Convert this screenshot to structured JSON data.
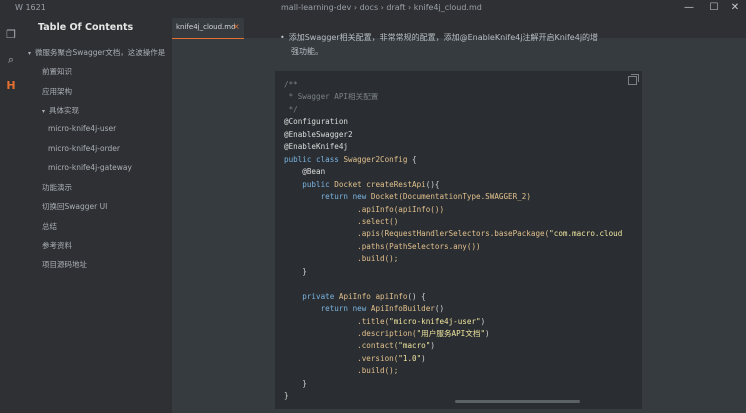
{
  "window": {
    "word_count": "W 1621",
    "path": "mall-learning-dev › docs › draft › knife4j_cloud.md",
    "controls": {
      "minimize": "—",
      "maximize": "☐",
      "close": "✕"
    }
  },
  "colors": {
    "accent": "#e57030",
    "comment": "#7a8187",
    "keyword": "#7ab3e0",
    "type": "#e2c08d",
    "string": "#f0e6a0",
    "annotation": "#dcdcdc",
    "method": "#e2c08d",
    "plain": "#d4d4d4"
  },
  "activity": {
    "icons": [
      {
        "name": "files-icon",
        "glyph": "❐"
      },
      {
        "name": "search-icon",
        "glyph": "⌕"
      },
      {
        "name": "outline-icon",
        "glyph": "H"
      }
    ]
  },
  "sidebar": {
    "title": "Table Of Contents",
    "items": [
      {
        "label": "微服务聚合Swagger文档，这波操作是",
        "tri": "▾",
        "level": 0
      },
      {
        "label": "前置知识",
        "tri": "",
        "level": 1
      },
      {
        "label": "应用架构",
        "tri": "",
        "level": 1
      },
      {
        "label": "具体实现",
        "tri": "▾",
        "level": 1
      },
      {
        "label": "micro-knife4j-user",
        "tri": "",
        "level": 2
      },
      {
        "label": "micro-knife4j-order",
        "tri": "",
        "level": 2
      },
      {
        "label": "micro-knife4j-gateway",
        "tri": "",
        "level": 2
      },
      {
        "label": "功能演示",
        "tri": "",
        "level": 1
      },
      {
        "label": "切换回Swagger UI",
        "tri": "",
        "level": 1
      },
      {
        "label": "总结",
        "tri": "",
        "level": 1
      },
      {
        "label": "参考资料",
        "tri": "",
        "level": 1
      },
      {
        "label": "项目源码地址",
        "tri": "",
        "level": 1
      }
    ]
  },
  "editor": {
    "tab": {
      "label": "knife4j_cloud.md",
      "close": "×"
    },
    "paragraph": {
      "bullet": "•",
      "line1": "添加Swagger相关配置，非常常规的配置，添加@EnableKnife4j注解开启Knife4j的增",
      "line2": "强功能。"
    },
    "code_lines": [
      [
        {
          "t": "/**",
          "c": "comment"
        }
      ],
      [
        {
          "t": " * Swagger API相关配置",
          "c": "comment"
        }
      ],
      [
        {
          "t": " */",
          "c": "comment"
        }
      ],
      [
        {
          "t": "@Configuration",
          "c": "annotation"
        }
      ],
      [
        {
          "t": "@EnableSwagger2",
          "c": "annotation"
        }
      ],
      [
        {
          "t": "@EnableKnife4j",
          "c": "annotation"
        }
      ],
      [
        {
          "t": "public class ",
          "c": "keyword"
        },
        {
          "t": "Swagger2Config",
          "c": "type"
        },
        {
          "t": " {",
          "c": "plain"
        }
      ],
      [
        {
          "t": "    @Bean",
          "c": "annotation"
        }
      ],
      [
        {
          "t": "    public ",
          "c": "keyword"
        },
        {
          "t": "Docket",
          "c": "type"
        },
        {
          "t": " createRestApi",
          "c": "method"
        },
        {
          "t": "(){",
          "c": "plain"
        }
      ],
      [
        {
          "t": "        return new ",
          "c": "keyword"
        },
        {
          "t": "Docket",
          "c": "type"
        },
        {
          "t": "(DocumentationType.SWAGGER_2)",
          "c": "method"
        }
      ],
      [
        {
          "t": "                .apiInfo(apiInfo())",
          "c": "method"
        }
      ],
      [
        {
          "t": "                .select()",
          "c": "method"
        }
      ],
      [
        {
          "t": "                .apis(RequestHandlerSelectors.basePackage(",
          "c": "method"
        },
        {
          "t": "\"com.macro.cloud",
          "c": "string"
        }
      ],
      [
        {
          "t": "                .paths(PathSelectors.any())",
          "c": "method"
        }
      ],
      [
        {
          "t": "                .build();",
          "c": "method"
        }
      ],
      [
        {
          "t": "    }",
          "c": "plain"
        }
      ],
      [
        {
          "t": "",
          "c": "plain"
        }
      ],
      [
        {
          "t": "    private ",
          "c": "keyword"
        },
        {
          "t": "ApiInfo",
          "c": "type"
        },
        {
          "t": " apiInfo",
          "c": "method"
        },
        {
          "t": "() {",
          "c": "plain"
        }
      ],
      [
        {
          "t": "        return new ",
          "c": "keyword"
        },
        {
          "t": "ApiInfoBuilder",
          "c": "type"
        },
        {
          "t": "()",
          "c": "plain"
        }
      ],
      [
        {
          "t": "                .title(",
          "c": "method"
        },
        {
          "t": "\"micro-knife4j-user\"",
          "c": "string"
        },
        {
          "t": ")",
          "c": "plain"
        }
      ],
      [
        {
          "t": "                .description(",
          "c": "method"
        },
        {
          "t": "\"用户服务API文档\"",
          "c": "string"
        },
        {
          "t": ")",
          "c": "plain"
        }
      ],
      [
        {
          "t": "                .contact(",
          "c": "method"
        },
        {
          "t": "\"macro\"",
          "c": "string"
        },
        {
          "t": ")",
          "c": "plain"
        }
      ],
      [
        {
          "t": "                .version(",
          "c": "method"
        },
        {
          "t": "\"1.0\"",
          "c": "string"
        },
        {
          "t": ")",
          "c": "plain"
        }
      ],
      [
        {
          "t": "                .build();",
          "c": "method"
        }
      ],
      [
        {
          "t": "    }",
          "c": "plain"
        }
      ],
      [
        {
          "t": "}",
          "c": "plain"
        }
      ]
    ]
  }
}
